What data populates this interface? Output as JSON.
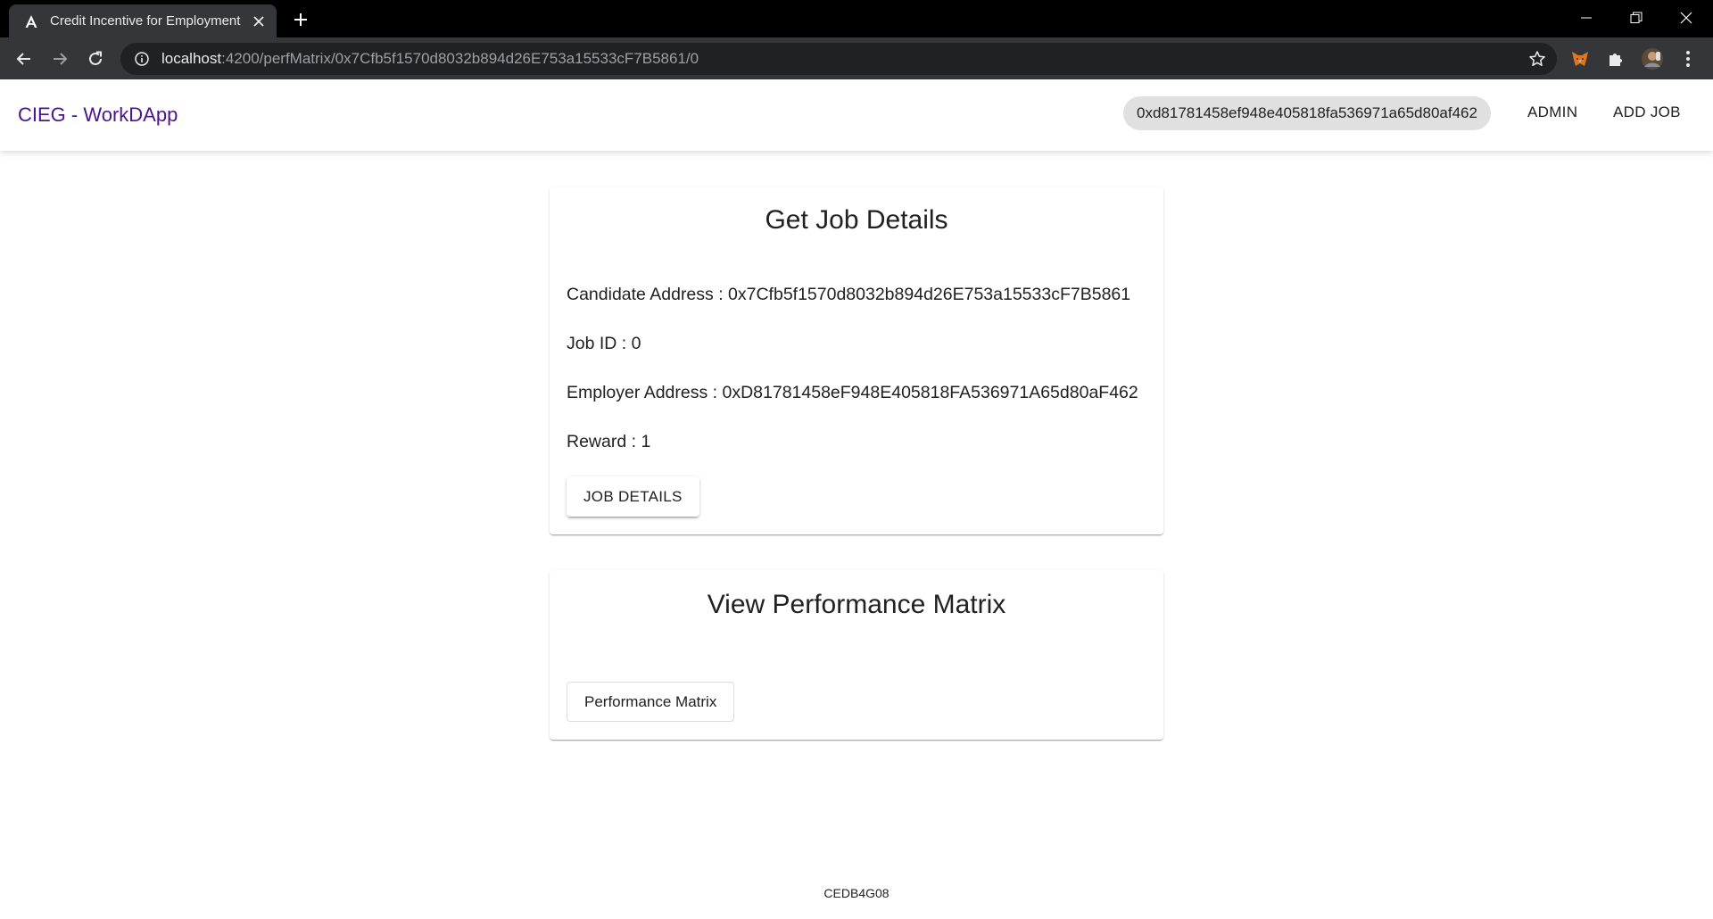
{
  "browser": {
    "tab_title": "Credit Incentive for Employment",
    "url_host": "localhost",
    "url_rest": ":4200/perfMatrix/0x7Cfb5f1570d8032b894d26E753a15533cF7B5861/0"
  },
  "header": {
    "brand": "CIEG - WorkDApp",
    "wallet_address": "0xd81781458ef948e405818fa536971a65d80af462",
    "nav_admin": "ADMIN",
    "nav_add_job": "ADD JOB"
  },
  "job_card": {
    "title": "Get Job Details",
    "candidate_address": "Candidate Address : 0x7Cfb5f1570d8032b894d26E753a15533cF7B5861",
    "job_id": "Job ID : 0",
    "employer_address": "Employer Address : 0xD81781458eF948E405818FA536971A65d80aF462",
    "reward": "Reward : 1",
    "button_label": "JOB DETAILS"
  },
  "perf_card": {
    "title": "View Performance Matrix",
    "button_label": "Performance Matrix"
  },
  "footer": {
    "text": "CEDB4G08"
  }
}
